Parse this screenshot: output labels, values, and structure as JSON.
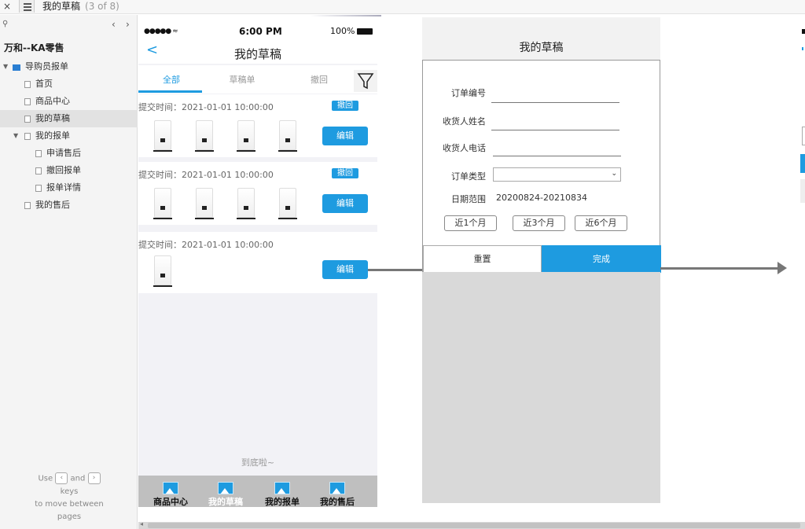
{
  "topbar": {
    "close": "×",
    "page_title": "我的草稿",
    "page_count": "(3 of 8)"
  },
  "sidebar": {
    "search_icon": "⚲",
    "nav_prev": "‹",
    "nav_next": "›",
    "project": "万和--KA零售",
    "tree": [
      {
        "label": "导购员报单",
        "level": 0,
        "expanded": true,
        "type": "folder"
      },
      {
        "label": "首页",
        "level": 1,
        "type": "page"
      },
      {
        "label": "商品中心",
        "level": 1,
        "type": "page"
      },
      {
        "label": "我的草稿",
        "level": 1,
        "type": "page",
        "selected": true
      },
      {
        "label": "我的报单",
        "level": 1,
        "expanded": true,
        "type": "page"
      },
      {
        "label": "申请售后",
        "level": 2,
        "type": "page"
      },
      {
        "label": "撤回报单",
        "level": 2,
        "type": "page"
      },
      {
        "label": "报单详情",
        "level": 2,
        "type": "page"
      },
      {
        "label": "我的售后",
        "level": 1,
        "type": "page"
      }
    ],
    "hint": {
      "use": "Use",
      "and": "and",
      "keys": "keys",
      "to_move": "to move between",
      "pages": "pages",
      "key_left": "‹",
      "key_right": "›"
    }
  },
  "phone": {
    "signal": "●●●●● ≈",
    "time": "6:00 PM",
    "battery": "100%",
    "back": "<",
    "title": "我的草稿",
    "tabs": [
      "全部",
      "草稿单",
      "撤回"
    ],
    "active_tab": 0,
    "cards": [
      {
        "time": "提交时间：2021-01-01 10:00:00",
        "badge": "撤回",
        "items": 4,
        "edit": "编辑"
      },
      {
        "time": "提交时间：2021-01-01 10:00:00",
        "badge": "撤回",
        "items": 4,
        "edit": "编辑"
      },
      {
        "time": "提交时间：2021-01-01 10:00:00",
        "badge": "",
        "items": 1,
        "edit": "编辑"
      }
    ],
    "bottom_text": "到底啦~",
    "tabbar": [
      "商品中心",
      "我的草稿",
      "我的报单",
      "我的售后"
    ],
    "tabbar_active": 1
  },
  "modal": {
    "title": "我的草稿",
    "fields": {
      "order_no": "订单编号",
      "receiver_name": "收货人姓名",
      "receiver_phone": "收货人电话",
      "order_type": "订单类型",
      "date_range": "日期范围"
    },
    "date_range_value": "20200824-20210834",
    "select_arrow": "⌄",
    "quick": [
      "近1个月",
      "近3个月",
      "近6个月"
    ],
    "reset": "重置",
    "done": "完成"
  },
  "colors": {
    "accent": "#1e9be0",
    "arrow": "#777777"
  }
}
